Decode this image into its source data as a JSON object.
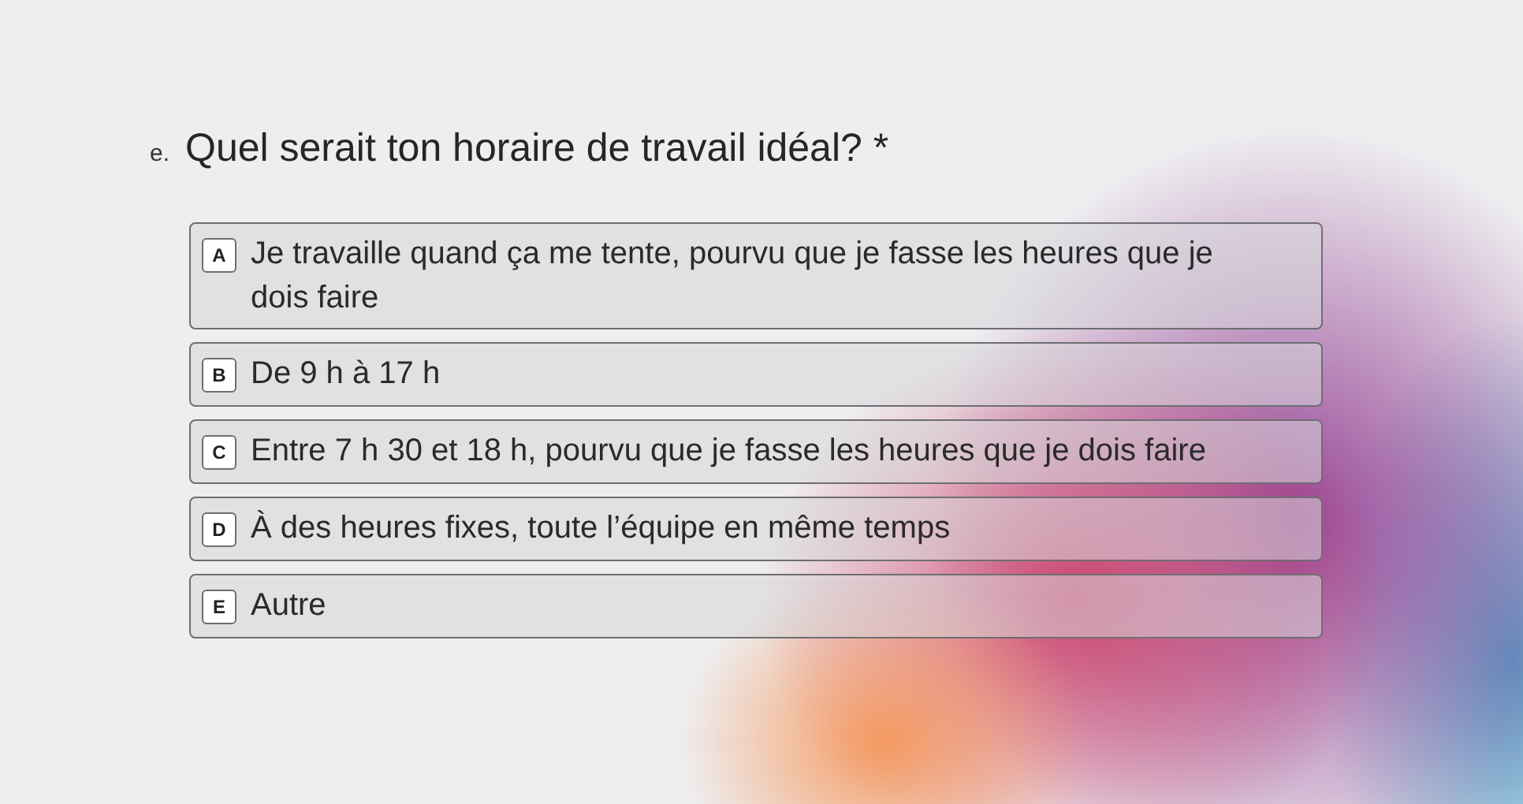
{
  "question": {
    "number": "e.",
    "text": "Quel serait ton horaire de travail idéal? *"
  },
  "choices": [
    {
      "key": "A",
      "label": "Je travaille quand ça me tente, pourvu que je fasse les heures que je dois faire",
      "selected": false
    },
    {
      "key": "B",
      "label": "De 9 h à 17 h",
      "selected": false
    },
    {
      "key": "C",
      "label": "Entre 7 h 30 et 18 h, pourvu que je fasse les heures que je dois faire",
      "selected": false
    },
    {
      "key": "D",
      "label": "À des heures fixes, toute l’équipe en même temps",
      "selected": false
    },
    {
      "key": "E",
      "label": "Autre",
      "selected": false
    }
  ]
}
